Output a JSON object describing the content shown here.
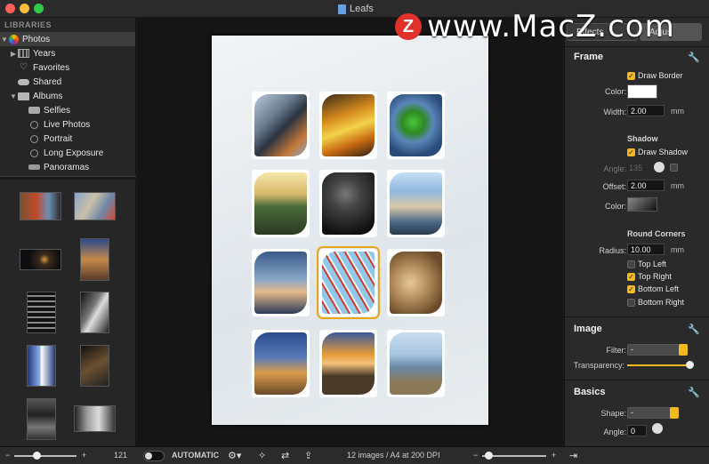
{
  "window": {
    "title": "Leafs"
  },
  "watermark": {
    "badge": "Z",
    "text": "www.MacZ.com"
  },
  "sidebar": {
    "header": "LIBRARIES",
    "items": [
      {
        "label": "Photos",
        "icon": "photos-icon",
        "expanded": true,
        "selected": true
      },
      {
        "label": "Years",
        "icon": "grid-icon"
      },
      {
        "label": "Favorites",
        "icon": "heart-icon"
      },
      {
        "label": "Shared",
        "icon": "cloud-icon"
      },
      {
        "label": "Albums",
        "icon": "folder-icon",
        "expanded": true
      },
      {
        "label": "Selfies",
        "icon": "camera-icon"
      },
      {
        "label": "Live Photos",
        "icon": "live-photo-icon"
      },
      {
        "label": "Portrait",
        "icon": "portrait-icon"
      },
      {
        "label": "Long Exposure",
        "icon": "long-exposure-icon"
      },
      {
        "label": "Panoramas",
        "icon": "panorama-icon"
      }
    ]
  },
  "inspector": {
    "tabs": [
      "Effects",
      "Adjus"
    ],
    "frame": {
      "title": "Frame",
      "draw_border": "Draw Border",
      "color_label": "Color:",
      "width_label": "Width:",
      "width_value": "2.00",
      "width_unit": "mm"
    },
    "shadow": {
      "title": "Shadow",
      "draw_shadow": "Draw Shadow",
      "angle_label": "Angle:",
      "angle_value": "135",
      "offset_label": "Offset:",
      "offset_value": "2.00",
      "offset_unit": "mm",
      "color_label": "Color:"
    },
    "round_corners": {
      "title": "Round Corners",
      "radius_label": "Radius:",
      "radius_value": "10.00",
      "radius_unit": "mm",
      "top_left": "Top Left",
      "top_right": "Top Right",
      "bottom_left": "Bottom Left",
      "bottom_right": "Bottom Right"
    },
    "image": {
      "title": "Image",
      "filter_label": "Filter:",
      "filter_value": "-",
      "transparency_label": "Transparency:",
      "transparency_value": 1.0
    },
    "basics": {
      "title": "Basics",
      "shape_label": "Shape:",
      "shape_value": "-",
      "angle_label": "Angle:",
      "angle_value": "0"
    }
  },
  "bottombar": {
    "minus": "−",
    "plus": "+",
    "zoom_count": "121",
    "mode": "AUTOMATIC",
    "status": "12 images / A4 at 200 DPI"
  }
}
